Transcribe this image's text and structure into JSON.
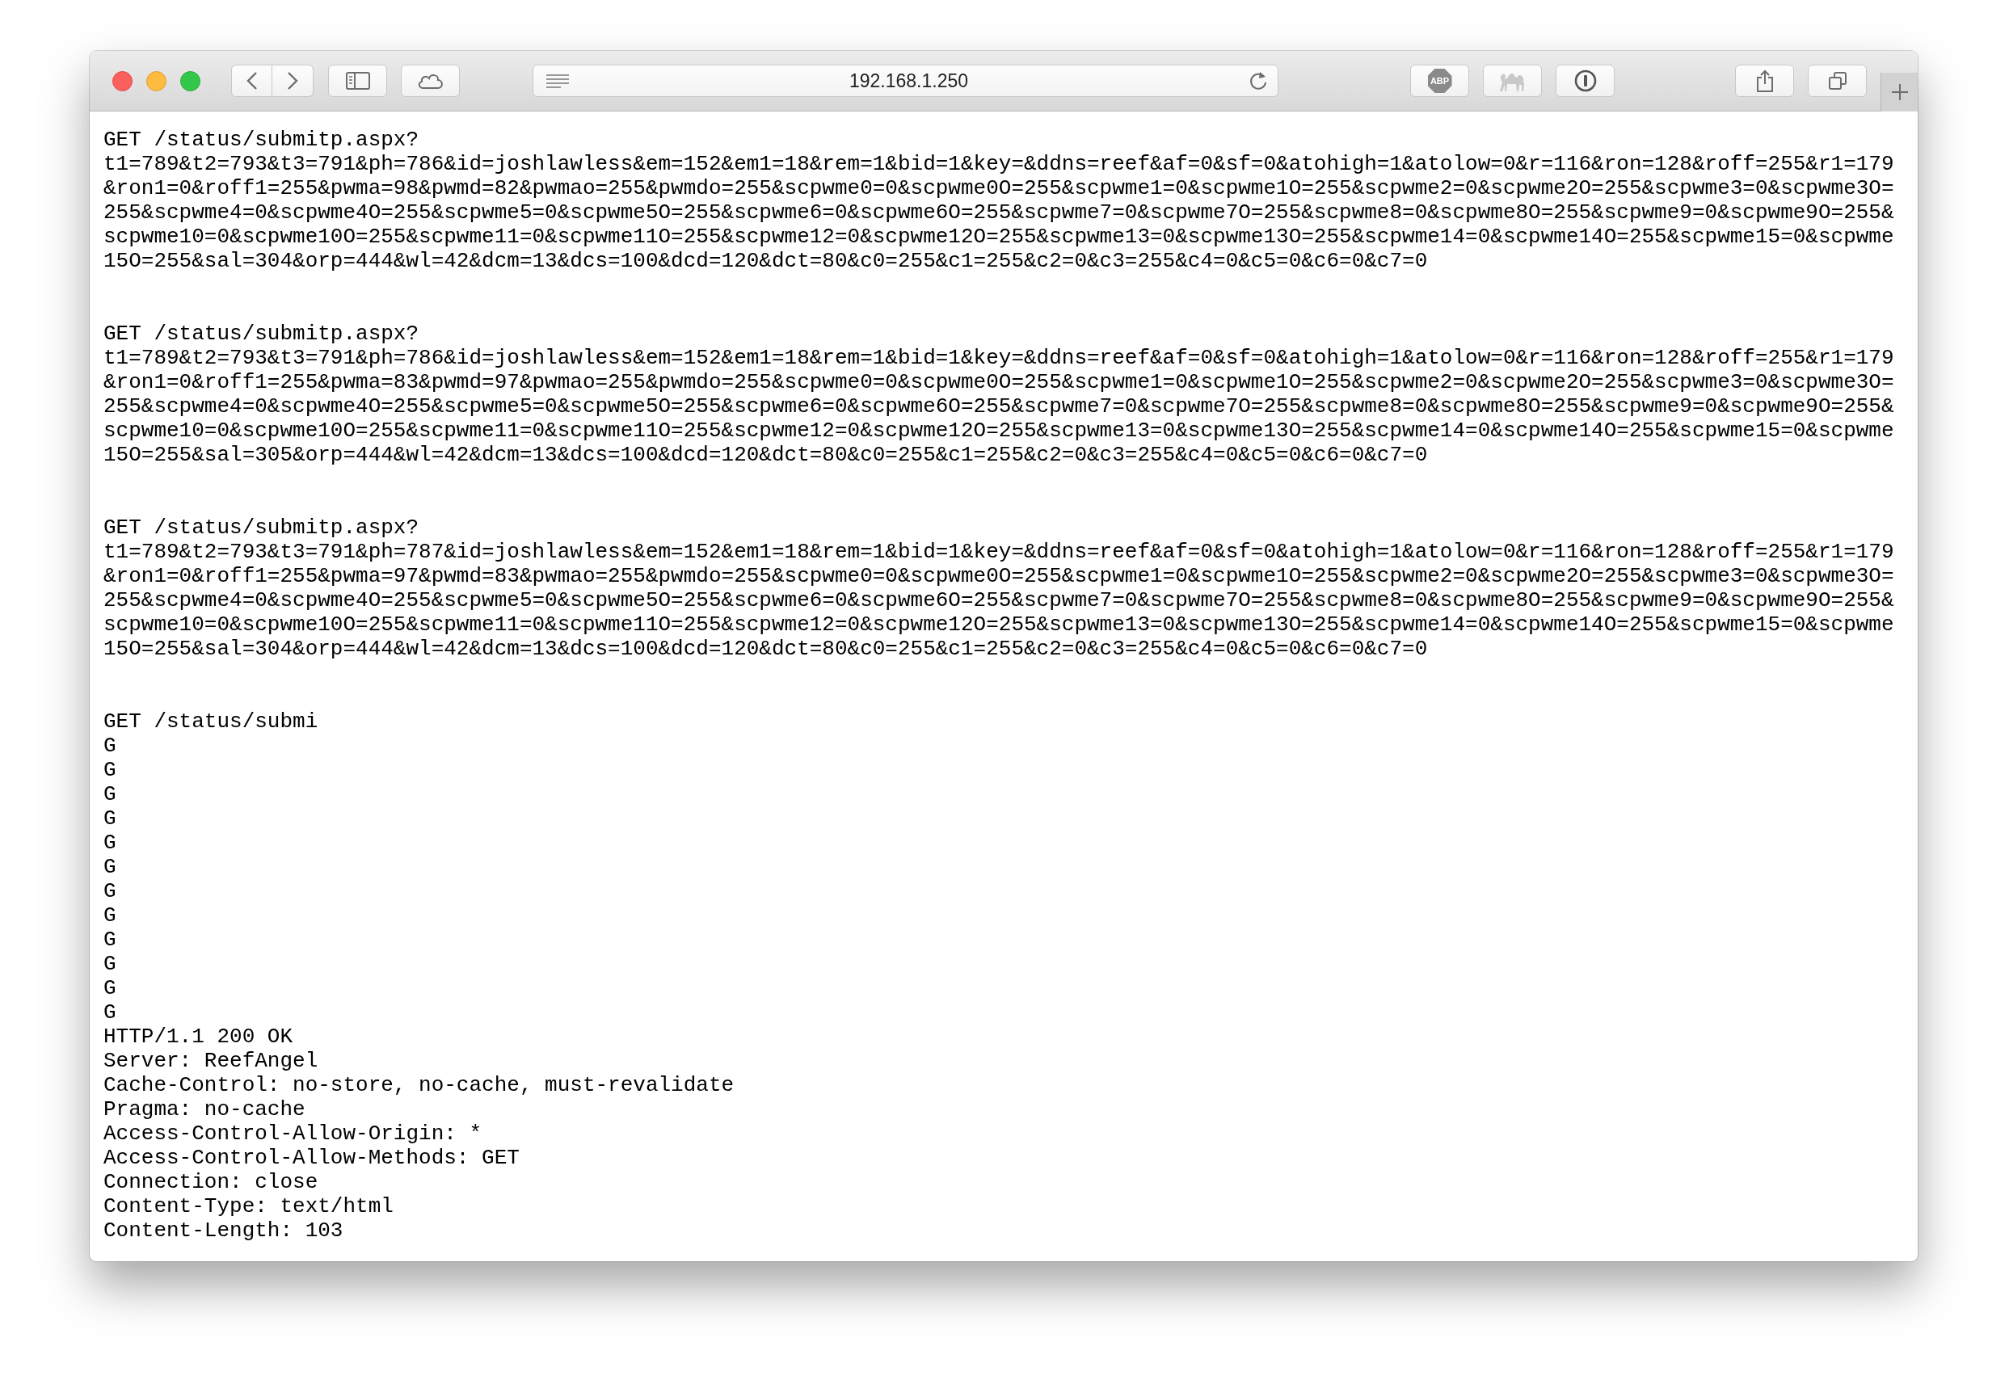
{
  "toolbar": {
    "address": "192.168.1.250",
    "adblock_label": "ABP"
  },
  "blocks": [
    {
      "lines": [
        "GET /status/submitp.aspx?",
        "t1=789&t2=793&t3=791&ph=786&id=joshlawless&em=152&em1=18&rem=1&bid=1&key=&ddns=reef&af=0&sf=0&atohigh=1&atolow=0&r=116&ron=128&roff=255&r1=179",
        "&ron1=0&roff1=255&pwma=98&pwmd=82&pwmao=255&pwmdo=255&scpwme0=0&scpwme0O=255&scpwme1=0&scpwme1O=255&scpwme2=0&scpwme2O=255&scpwme3=0&scpwme3O=",
        "255&scpwme4=0&scpwme4O=255&scpwme5=0&scpwme5O=255&scpwme6=0&scpwme6O=255&scpwme7=0&scpwme7O=255&scpwme8=0&scpwme8O=255&scpwme9=0&scpwme9O=255&",
        "scpwme10=0&scpwme10O=255&scpwme11=0&scpwme11O=255&scpwme12=0&scpwme12O=255&scpwme13=0&scpwme13O=255&scpwme14=0&scpwme14O=255&scpwme15=0&scpwme",
        "15O=255&sal=304&orp=444&wl=42&dcm=13&dcs=100&dcd=120&dct=80&c0=255&c1=255&c2=0&c3=255&c4=0&c5=0&c6=0&c7=0"
      ]
    },
    {
      "lines": [
        "GET /status/submitp.aspx?",
        "t1=789&t2=793&t3=791&ph=786&id=joshlawless&em=152&em1=18&rem=1&bid=1&key=&ddns=reef&af=0&sf=0&atohigh=1&atolow=0&r=116&ron=128&roff=255&r1=179",
        "&ron1=0&roff1=255&pwma=83&pwmd=97&pwmao=255&pwmdo=255&scpwme0=0&scpwme0O=255&scpwme1=0&scpwme1O=255&scpwme2=0&scpwme2O=255&scpwme3=0&scpwme3O=",
        "255&scpwme4=0&scpwme4O=255&scpwme5=0&scpwme5O=255&scpwme6=0&scpwme6O=255&scpwme7=0&scpwme7O=255&scpwme8=0&scpwme8O=255&scpwme9=0&scpwme9O=255&",
        "scpwme10=0&scpwme10O=255&scpwme11=0&scpwme11O=255&scpwme12=0&scpwme12O=255&scpwme13=0&scpwme13O=255&scpwme14=0&scpwme14O=255&scpwme15=0&scpwme",
        "15O=255&sal=305&orp=444&wl=42&dcm=13&dcs=100&dcd=120&dct=80&c0=255&c1=255&c2=0&c3=255&c4=0&c5=0&c6=0&c7=0"
      ]
    },
    {
      "lines": [
        "GET /status/submitp.aspx?",
        "t1=789&t2=793&t3=791&ph=787&id=joshlawless&em=152&em1=18&rem=1&bid=1&key=&ddns=reef&af=0&sf=0&atohigh=1&atolow=0&r=116&ron=128&roff=255&r1=179",
        "&ron1=0&roff1=255&pwma=97&pwmd=83&pwmao=255&pwmdo=255&scpwme0=0&scpwme0O=255&scpwme1=0&scpwme1O=255&scpwme2=0&scpwme2O=255&scpwme3=0&scpwme3O=",
        "255&scpwme4=0&scpwme4O=255&scpwme5=0&scpwme5O=255&scpwme6=0&scpwme6O=255&scpwme7=0&scpwme7O=255&scpwme8=0&scpwme8O=255&scpwme9=0&scpwme9O=255&",
        "scpwme10=0&scpwme10O=255&scpwme11=0&scpwme11O=255&scpwme12=0&scpwme12O=255&scpwme13=0&scpwme13O=255&scpwme14=0&scpwme14O=255&scpwme15=0&scpwme",
        "15O=255&sal=304&orp=444&wl=42&dcm=13&dcs=100&dcd=120&dct=80&c0=255&c1=255&c2=0&c3=255&c4=0&c5=0&c6=0&c7=0"
      ]
    },
    {
      "lines": [
        "GET /status/submi",
        "G",
        "G",
        "G",
        "G",
        "G",
        "G",
        "G",
        "G",
        "G",
        "G",
        "G",
        "G",
        "HTTP/1.1 200 OK",
        "Server: ReefAngel",
        "Cache-Control: no-store, no-cache, must-revalidate",
        "Pragma: no-cache",
        "Access-Control-Allow-Origin: *",
        "Access-Control-Allow-Methods: GET",
        "Connection: close",
        "Content-Type: text/html",
        "Content-Length: 103"
      ]
    }
  ]
}
